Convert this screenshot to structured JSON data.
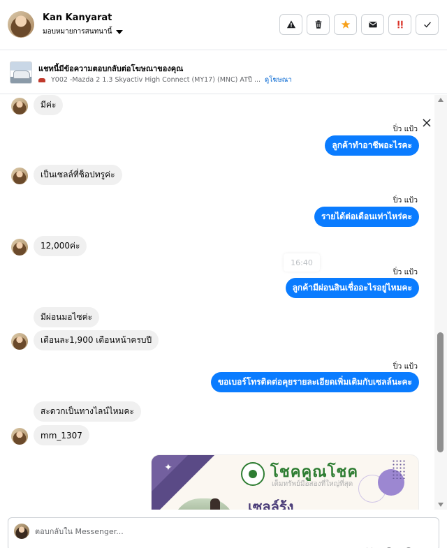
{
  "header": {
    "name": "Kan Kanyarat",
    "assign_label": "มอบหมายการสนทนานี้",
    "actions": [
      "warning-icon",
      "trash-icon",
      "star-icon",
      "mail-icon",
      "priority-icon",
      "check-icon"
    ]
  },
  "ad": {
    "title": "แชทนี้มีข้อความตอบกลับต่อโฆษณาของคุณ",
    "subtitle": "Y002 -Mazda 2 1.3 Skyactiv High Connect (MY17) (MNC) ATปี ...",
    "link": "ดูโฆษณา"
  },
  "messages": {
    "m1": "มีค่ะ",
    "sender1": "ปิ่ว แป้ว",
    "m2": "ลูกค้าทำอาชีพอะไรคะ",
    "m3": "เป็นเซลล์ที่ช็อปทรูค่ะ",
    "sender2": "ปิ่ว แป้ว",
    "m4": "รายได้ต่อเดือนเท่าไหร่คะ",
    "m5": "12,000ค่ะ",
    "timestamp": "16:40",
    "sender3": "ปิ่ว แป้ว",
    "m6": "ลูกค้ามีผ่อนสินเชื่ออะไรอยู่ไหมคะ",
    "m7": "มีผ่อนมอไซค่ะ",
    "m8": "เดือนละ1,900 เดือนหน้าครบปี",
    "sender4": "ปิ่ว แป้ว",
    "m9": "ขอเบอร์โทรติดต่อคุยรายละเอียดเพิ่มเติมกับเซลล์นะคะ",
    "m10": "สะดวกเป็นทางไลน์ไหมคะ",
    "m11": "mm_1307"
  },
  "image_card": {
    "brand": "โชคคูณโชค",
    "tagline": "เต็มทรัพย์มือสองที่ใหญ่ที่สุด",
    "headline": "เซลล์รุ้ง"
  },
  "composer": {
    "placeholder": "ตอบกลับใน Messenger..."
  },
  "colors": {
    "outgoing_bubble": "#0a7cff",
    "incoming_bubble": "#f0f0f0",
    "star": "#f7a11b",
    "priority": "#d93025"
  }
}
